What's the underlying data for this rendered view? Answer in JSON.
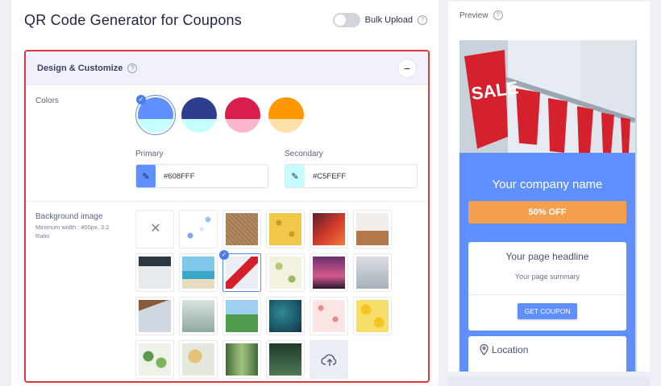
{
  "app": {
    "title": "QR Code Generator for Coupons"
  },
  "bulk_upload": {
    "label": "Bulk Upload",
    "enabled": false
  },
  "design": {
    "title": "Design & Customize",
    "collapse_symbol": "−",
    "colors_label": "Colors",
    "swatches": [
      {
        "primary": "#608FFF",
        "secondary": "#C5FEFF",
        "selected": true
      },
      {
        "primary": "#2F3E8C",
        "secondary": "#C5FEFF",
        "selected": false
      },
      {
        "primary": "#D91E4E",
        "secondary": "#FBB6CE",
        "selected": false
      },
      {
        "primary": "#FF9800",
        "secondary": "#FFE0A8",
        "selected": false
      }
    ],
    "primary": {
      "label": "Primary",
      "value": "#608FFF"
    },
    "secondary": {
      "label": "Secondary",
      "value": "#C5FEFF"
    },
    "background": {
      "label": "Background image",
      "hint": "Minimum width : 400px, 3:2 Ratio",
      "selected_index": 8
    }
  },
  "preview": {
    "title": "Preview",
    "company": "Your company name",
    "offer": "50% OFF",
    "headline": "Your page headline",
    "summary": "Your page summary",
    "cta": "GET COUPON",
    "location": "Location",
    "sale_text": "SALE"
  },
  "colors": {
    "accent": "#608FFF",
    "danger": "#E0353B",
    "offer": "#F5A04E"
  }
}
